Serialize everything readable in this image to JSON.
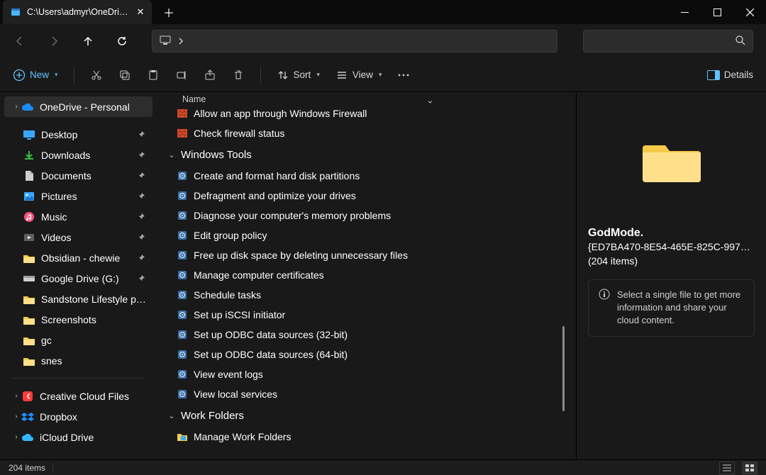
{
  "tab": {
    "title": "C:\\Users\\admyr\\OneDrive\\Des"
  },
  "toolbar": {
    "new": "New",
    "sort": "Sort",
    "view": "View",
    "details": "Details"
  },
  "columns": {
    "name": "Name"
  },
  "sidebar": {
    "top": {
      "label": "OneDrive - Personal"
    },
    "quick": [
      {
        "label": "Desktop"
      },
      {
        "label": "Downloads"
      },
      {
        "label": "Documents"
      },
      {
        "label": "Pictures"
      },
      {
        "label": "Music"
      },
      {
        "label": "Videos"
      },
      {
        "label": "Obsidian - chewie"
      },
      {
        "label": "Google Drive (G:)"
      },
      {
        "label": "Sandstone Lifestyle photos"
      },
      {
        "label": "Screenshots"
      },
      {
        "label": "gc"
      },
      {
        "label": "snes"
      }
    ],
    "cloud": [
      {
        "label": "Creative Cloud Files"
      },
      {
        "label": "Dropbox"
      },
      {
        "label": "iCloud Drive"
      }
    ]
  },
  "content": {
    "groups": [
      {
        "title": "",
        "items": [
          {
            "label": "Allow an app through Windows Firewall",
            "icon": "firewall"
          },
          {
            "label": "Check firewall status",
            "icon": "firewall"
          }
        ]
      },
      {
        "title": "Windows Tools",
        "items": [
          {
            "label": "Create and format hard disk partitions",
            "icon": "tool"
          },
          {
            "label": "Defragment and optimize your drives",
            "icon": "tool"
          },
          {
            "label": "Diagnose your computer's memory problems",
            "icon": "tool"
          },
          {
            "label": "Edit group policy",
            "icon": "tool"
          },
          {
            "label": "Free up disk space by deleting unnecessary files",
            "icon": "tool"
          },
          {
            "label": "Manage computer certificates",
            "icon": "tool"
          },
          {
            "label": "Schedule tasks",
            "icon": "tool"
          },
          {
            "label": "Set up iSCSI initiator",
            "icon": "tool"
          },
          {
            "label": "Set up ODBC data sources (32-bit)",
            "icon": "tool"
          },
          {
            "label": "Set up ODBC data sources (64-bit)",
            "icon": "tool"
          },
          {
            "label": "View event logs",
            "icon": "tool"
          },
          {
            "label": "View local services",
            "icon": "tool"
          }
        ]
      },
      {
        "title": "Work Folders",
        "items": [
          {
            "label": "Manage Work Folders",
            "icon": "workfolder"
          }
        ]
      }
    ]
  },
  "details": {
    "title": "GodMode.",
    "subtitle": "{ED7BA470-8E54-465E-825C-997…",
    "count": "(204 items)",
    "tip": "Select a single file to get more information and share your cloud content."
  },
  "status": {
    "left": "204 items"
  }
}
